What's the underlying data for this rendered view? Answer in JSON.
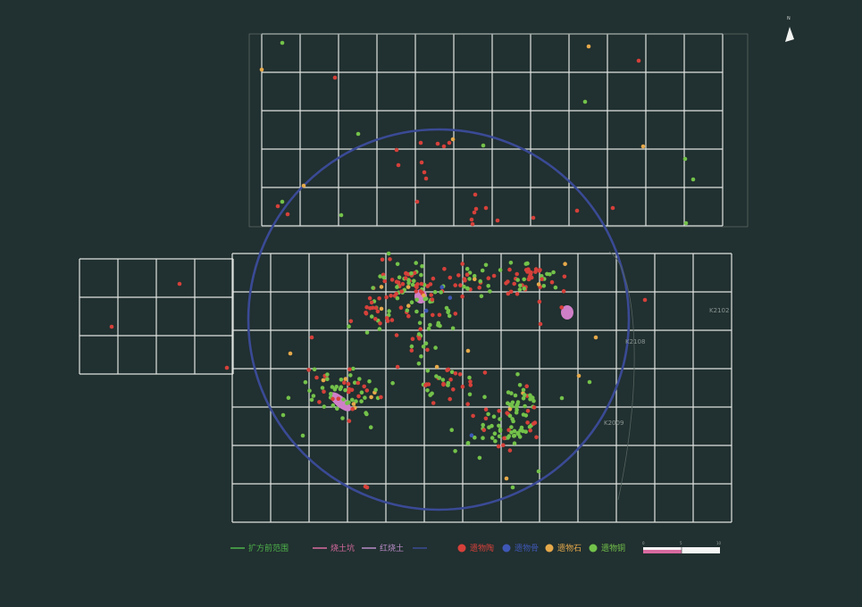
{
  "map": {
    "north_label": "N",
    "colors": {
      "background": "#213030",
      "grid": "#dfe3e0",
      "circle": "#3a4a95",
      "red": "#d6403a",
      "blue": "#3e57b6",
      "yellow": "#e6a94a",
      "green": "#73c24a",
      "pink": "#cf7fc8",
      "line_green": "#4db24a",
      "line_pink": "#d86aa0",
      "line_lilac": "#b98cc8"
    },
    "grid_tags": [
      "K2102",
      "K2108",
      "K2009"
    ],
    "legend": [
      {
        "kind": "line",
        "label": "扩方前范围",
        "color_key": "line_green"
      },
      {
        "kind": "line",
        "label": "烧土坑",
        "color_key": "line_pink"
      },
      {
        "kind": "line",
        "label": "红烧土",
        "color_key": "line_lilac"
      },
      {
        "kind": "line",
        "label": "",
        "color_key": "circle"
      },
      {
        "kind": "dot",
        "label": "遗物陶",
        "color_key": "red"
      },
      {
        "kind": "dot",
        "label": "遗物骨",
        "color_key": "blue"
      },
      {
        "kind": "dot",
        "label": "遗物石",
        "color_key": "yellow"
      },
      {
        "kind": "dot",
        "label": "遗物铜",
        "color_key": "green"
      }
    ]
  }
}
